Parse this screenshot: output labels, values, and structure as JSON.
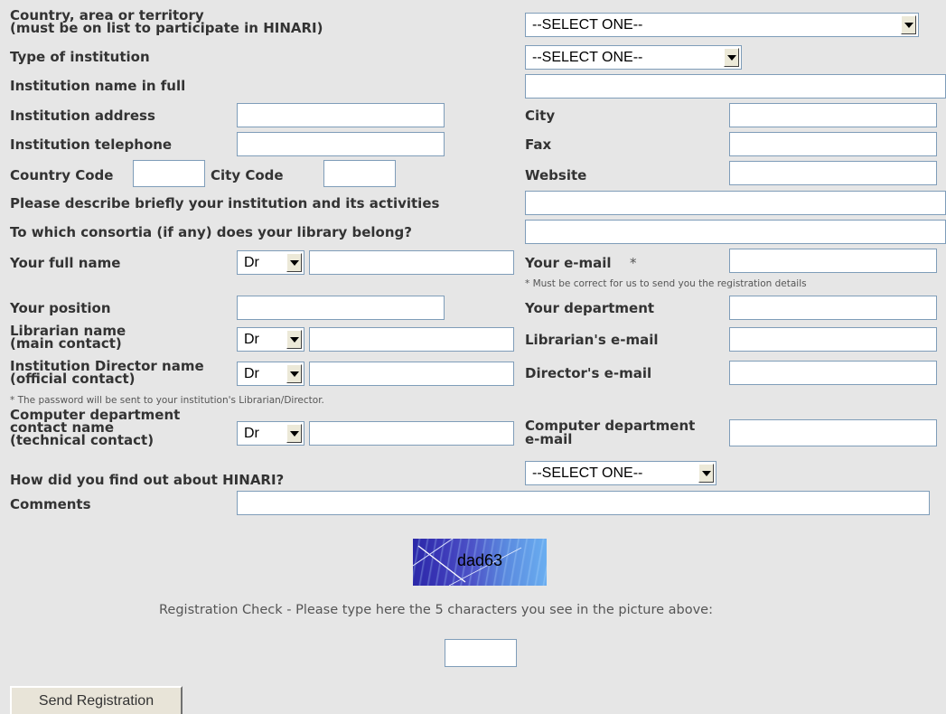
{
  "fields": {
    "country": {
      "label": "Country, area or territory",
      "sublabel": "(must be on list to participate in HINARI)",
      "value": "--SELECT ONE--"
    },
    "institution_type": {
      "label": "Type of institution",
      "value": "--SELECT ONE--"
    },
    "institution_name": {
      "label": "Institution name in full",
      "value": ""
    },
    "institution_address": {
      "label": "Institution address",
      "value": ""
    },
    "city": {
      "label": "City",
      "value": ""
    },
    "institution_telephone": {
      "label": "Institution telephone",
      "value": ""
    },
    "fax": {
      "label": "Fax",
      "value": ""
    },
    "country_code": {
      "label": "Country Code",
      "value": ""
    },
    "city_code": {
      "label": "City Code",
      "value": ""
    },
    "website": {
      "label": "Website",
      "value": ""
    },
    "description": {
      "label": "Please describe briefly your institution and its activities",
      "value": ""
    },
    "consortia": {
      "label": "To which consortia (if any) does your library belong?",
      "value": ""
    },
    "full_name": {
      "label": "Your full name",
      "title": "Dr",
      "value": ""
    },
    "email": {
      "label": "Your e-mail",
      "required": "*",
      "note": "* Must be correct for us to send you the registration details",
      "value": ""
    },
    "position": {
      "label": "Your position",
      "value": ""
    },
    "department": {
      "label": "Your department",
      "value": ""
    },
    "librarian": {
      "label_line1": "Librarian name",
      "label_line2": "(main contact)",
      "title": "Dr",
      "value": ""
    },
    "librarian_email": {
      "label": "Librarian's e-mail",
      "value": ""
    },
    "director": {
      "label_line1": "Institution Director name",
      "label_line2": "(official contact)",
      "title": "Dr",
      "value": ""
    },
    "director_email": {
      "label": "Director's e-mail",
      "value": ""
    },
    "password_note": "* The password will be sent to your institution's Librarian/Director.",
    "computer_contact": {
      "label_line1": "Computer department",
      "label_line2": "contact name",
      "label_line3": "(technical contact)",
      "title": "Dr",
      "value": ""
    },
    "computer_email": {
      "label_line1": "Computer department",
      "label_line2": "e-mail",
      "value": ""
    },
    "how_found": {
      "label": "How did you find out about HINARI?",
      "value": "--SELECT ONE--"
    },
    "comments": {
      "label": "Comments",
      "value": ""
    }
  },
  "captcha": {
    "text": "dad63",
    "instruction": "Registration Check - Please type here the 5 characters you see in the picture above:",
    "value": ""
  },
  "submit": {
    "label": "Send Registration"
  }
}
